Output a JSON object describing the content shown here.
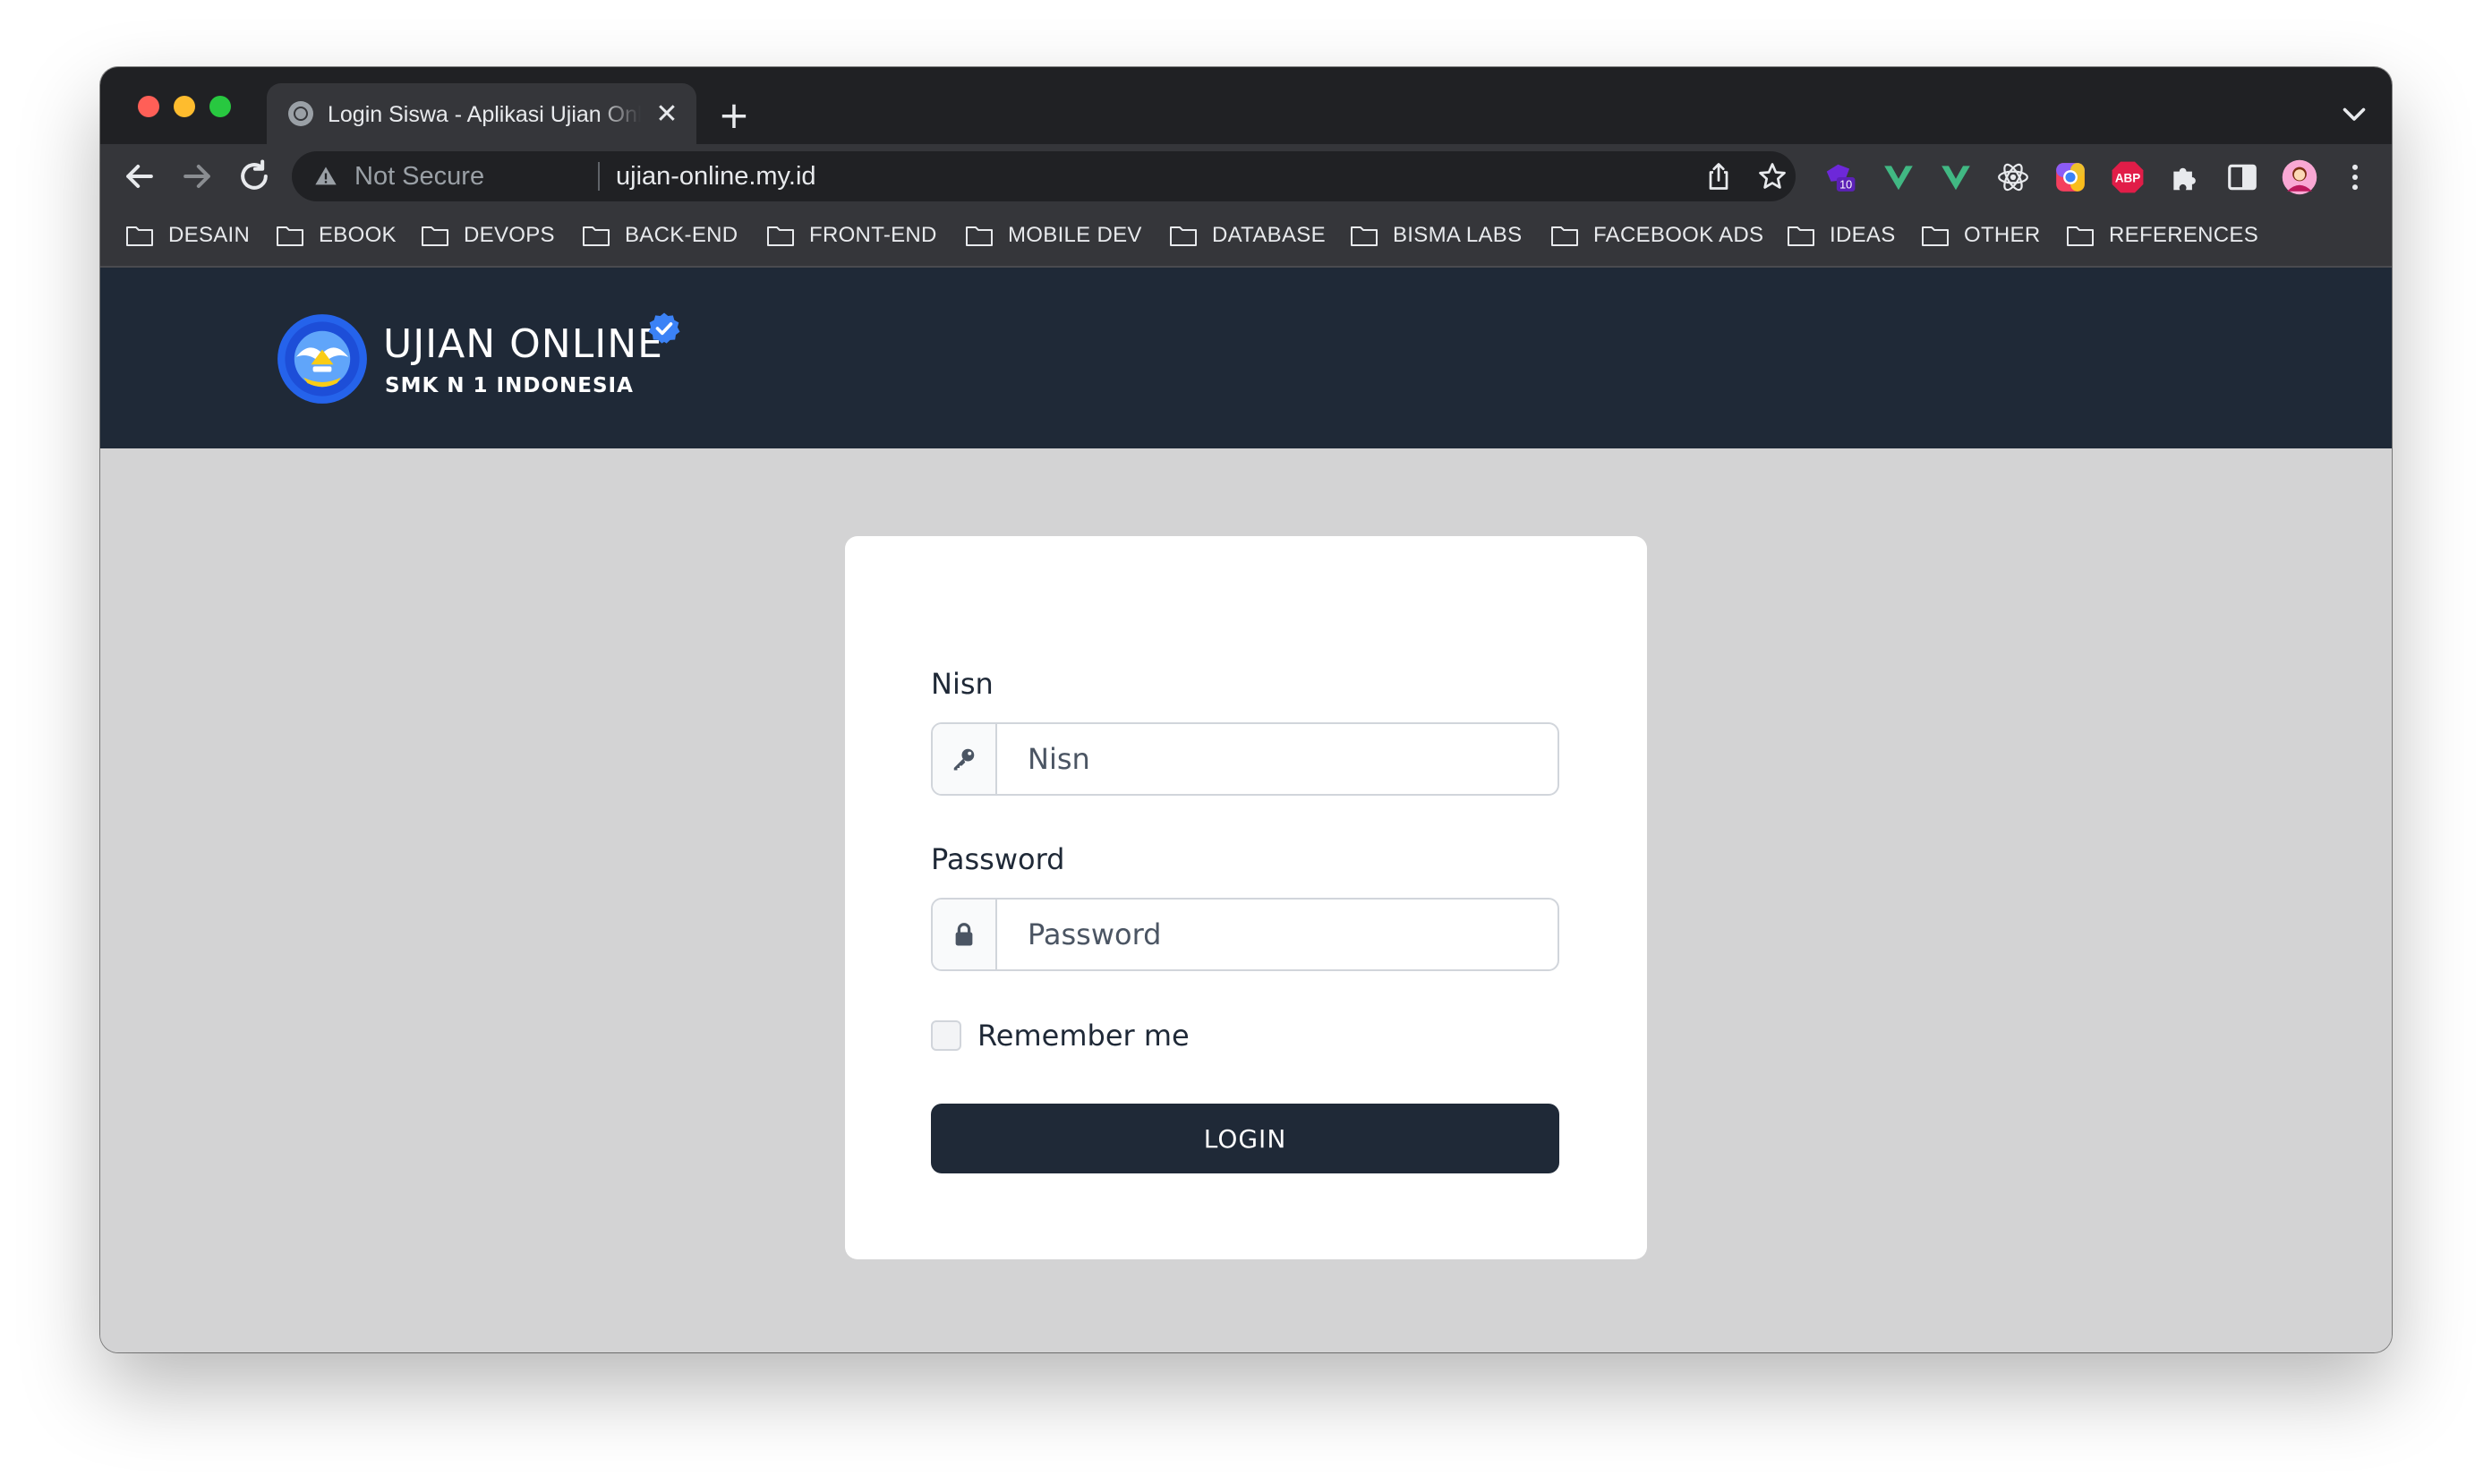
{
  "browser": {
    "tab": {
      "title": "Login Siswa - Aplikasi Ujian Online",
      "favicon": "globe-icon"
    },
    "new_tab_label": "+",
    "close_label": "✕",
    "address": {
      "security_label": "Not Secure",
      "url": "ujian-online.my.id"
    },
    "extensions": [
      "badge-ext-icon",
      "vue-devtools-icon",
      "vue-devtools-icon",
      "react-devtools-icon",
      "color-picker-icon",
      "adblock-plus-icon",
      "extensions-puzzle-icon",
      "sidebar-icon",
      "profile-avatar",
      "menu-kebab-icon"
    ],
    "extension_badge": "10",
    "abp_label": "ABP",
    "bookmarks": [
      "DESAIN",
      "EBOOK",
      "DEVOPS",
      "BACK-END",
      "FRONT-END",
      "MOBILE DEV",
      "DATABASE",
      "BISMA LABS",
      "FACEBOOK ADS",
      "IDEAS",
      "OTHER",
      "REFERENCES"
    ]
  },
  "header": {
    "title": "UJIAN ONLINE",
    "subtitle": "SMK N 1 INDONESIA",
    "logo": "tut-wuri-handayani-logo",
    "verified_icon": "verified-badge-icon"
  },
  "login": {
    "nisn_label": "Nisn",
    "nisn_placeholder": "Nisn",
    "nisn_value": "",
    "password_label": "Password",
    "password_placeholder": "Password",
    "password_value": "",
    "remember_label": "Remember me",
    "remember_checked": false,
    "submit_label": "LOGIN"
  },
  "colors": {
    "header_bg": "#1f2937",
    "page_bg": "#d3d3d4",
    "button_bg": "#1f2937",
    "verified": "#3b82f6"
  }
}
